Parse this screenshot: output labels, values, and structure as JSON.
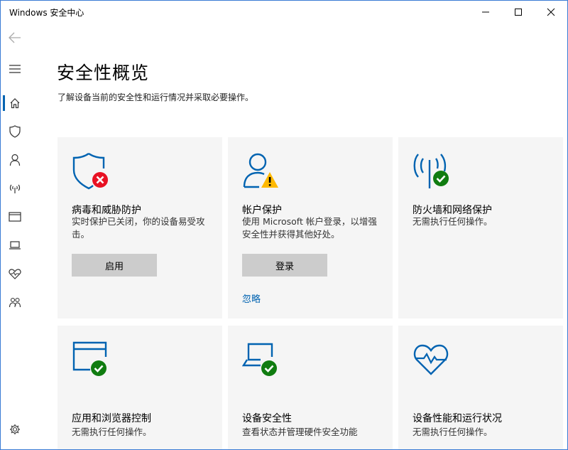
{
  "window": {
    "title": "Windows 安全中心"
  },
  "page": {
    "title": "安全性概览",
    "subtitle": "了解设备当前的安全性和运行情况并采取必要操作。"
  },
  "cards": [
    {
      "title": "病毒和威胁防护",
      "desc": "实时保护已关闭，你的设备易受攻击。",
      "button": "启用",
      "status": "error"
    },
    {
      "title": "帐户保护",
      "desc": "使用 Microsoft 帐户登录，以增强安全性并获得其他好处。",
      "button": "登录",
      "link": "忽略",
      "status": "warning"
    },
    {
      "title": "防火墙和网络保护",
      "desc": "无需执行任何操作。",
      "status": "ok"
    },
    {
      "title": "应用和浏览器控制",
      "desc": "无需执行任何操作。",
      "status": "ok"
    },
    {
      "title": "设备安全性",
      "desc": "查看状态并管理硬件安全功能",
      "status": "ok"
    },
    {
      "title": "设备性能和运行状况",
      "desc": "无需执行任何操作。",
      "status": "ok"
    }
  ],
  "colors": {
    "accent": "#0063b1",
    "error": "#e81123",
    "warning": "#ffb900",
    "ok": "#107c10",
    "card_bg": "#f5f5f5",
    "button_bg": "#cccccc"
  },
  "icons": {
    "back": "back-arrow-icon",
    "menu": "hamburger-menu-icon",
    "home": "home-icon",
    "shield": "shield-icon",
    "account": "person-icon",
    "network": "wifi-antenna-icon",
    "app": "browser-window-icon",
    "device": "laptop-icon",
    "health": "heart-icon",
    "family": "family-icon",
    "settings": "gear-icon"
  }
}
